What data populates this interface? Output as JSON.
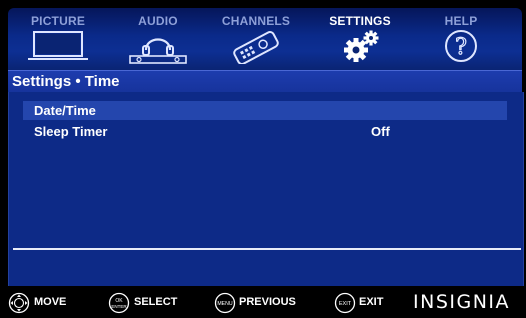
{
  "tabs": [
    {
      "label": "PICTURE",
      "icon": "tv-icon",
      "active": false
    },
    {
      "label": "AUDIO",
      "icon": "headphones-icon",
      "active": false
    },
    {
      "label": "CHANNELS",
      "icon": "remote-control-icon",
      "active": false
    },
    {
      "label": "SETTINGS",
      "icon": "gears-icon",
      "active": true
    },
    {
      "label": "HELP",
      "icon": "question-mark-icon",
      "active": false
    }
  ],
  "title": "Settings • Time",
  "menu": {
    "items": [
      {
        "label": "Date/Time",
        "value": "",
        "selected": true
      },
      {
        "label": "Sleep Timer",
        "value": "Off",
        "selected": false
      }
    ]
  },
  "hints": [
    {
      "icon": "dpad-icon",
      "button_text": "",
      "label": "MOVE"
    },
    {
      "icon": "ok-enter-button-icon",
      "button_text": "OK\nENTER",
      "label": "SELECT"
    },
    {
      "icon": "menu-button-icon",
      "button_text": "MENU",
      "label": "PREVIOUS"
    },
    {
      "icon": "exit-button-icon",
      "button_text": "EXIT",
      "label": "EXIT"
    }
  ],
  "brand": "INSIGNIA",
  "colors": {
    "tab_bar": "#0a2a8a",
    "title_strip": "#1d3cae",
    "panel": "#0d2a87",
    "selected_row": "#2446ad",
    "inactive_tab_text": "#8ea0d8"
  }
}
